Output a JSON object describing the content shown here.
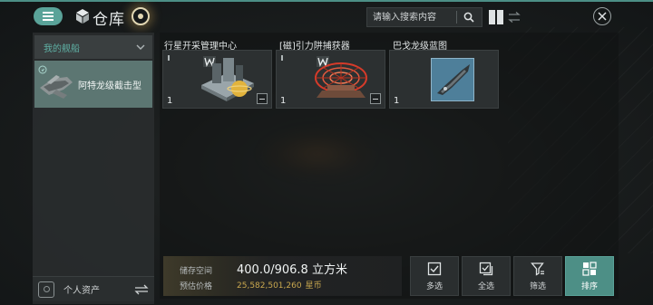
{
  "header": {
    "title": "仓库",
    "search_placeholder": "请输入搜索内容",
    "icons": [
      "menu-icon",
      "cube-icon",
      "target-icon",
      "search-icon",
      "grid-view-icon",
      "swap-icon",
      "close-icon"
    ]
  },
  "sidebar": {
    "header_label": "我的舰船",
    "ships": [
      {
        "name": "阿特龙级截击型"
      }
    ],
    "assets_label": "个人资产"
  },
  "items": [
    {
      "name": "行星开采管理中心",
      "count": "1"
    },
    {
      "name": "[磁]引力阱捕获器",
      "count": "1"
    },
    {
      "name": "巴戈龙级蓝图",
      "count": "1"
    }
  ],
  "storage": {
    "capacity_label": "储存空间",
    "capacity_value": "400.0/906.8 立方米",
    "price_label": "预估价格",
    "price_value": "25,582,501,260",
    "price_unit": "星币"
  },
  "actions": [
    {
      "label": "多选",
      "icon": "checkbox-icon"
    },
    {
      "label": "全选",
      "icon": "select-all-icon"
    },
    {
      "label": "筛选",
      "icon": "filter-icon"
    },
    {
      "label": "排序",
      "icon": "sort-icon",
      "active": true
    }
  ],
  "colors": {
    "accent": "#5aa399",
    "active_ship": "#5c7672",
    "price": "#c9a84f"
  }
}
